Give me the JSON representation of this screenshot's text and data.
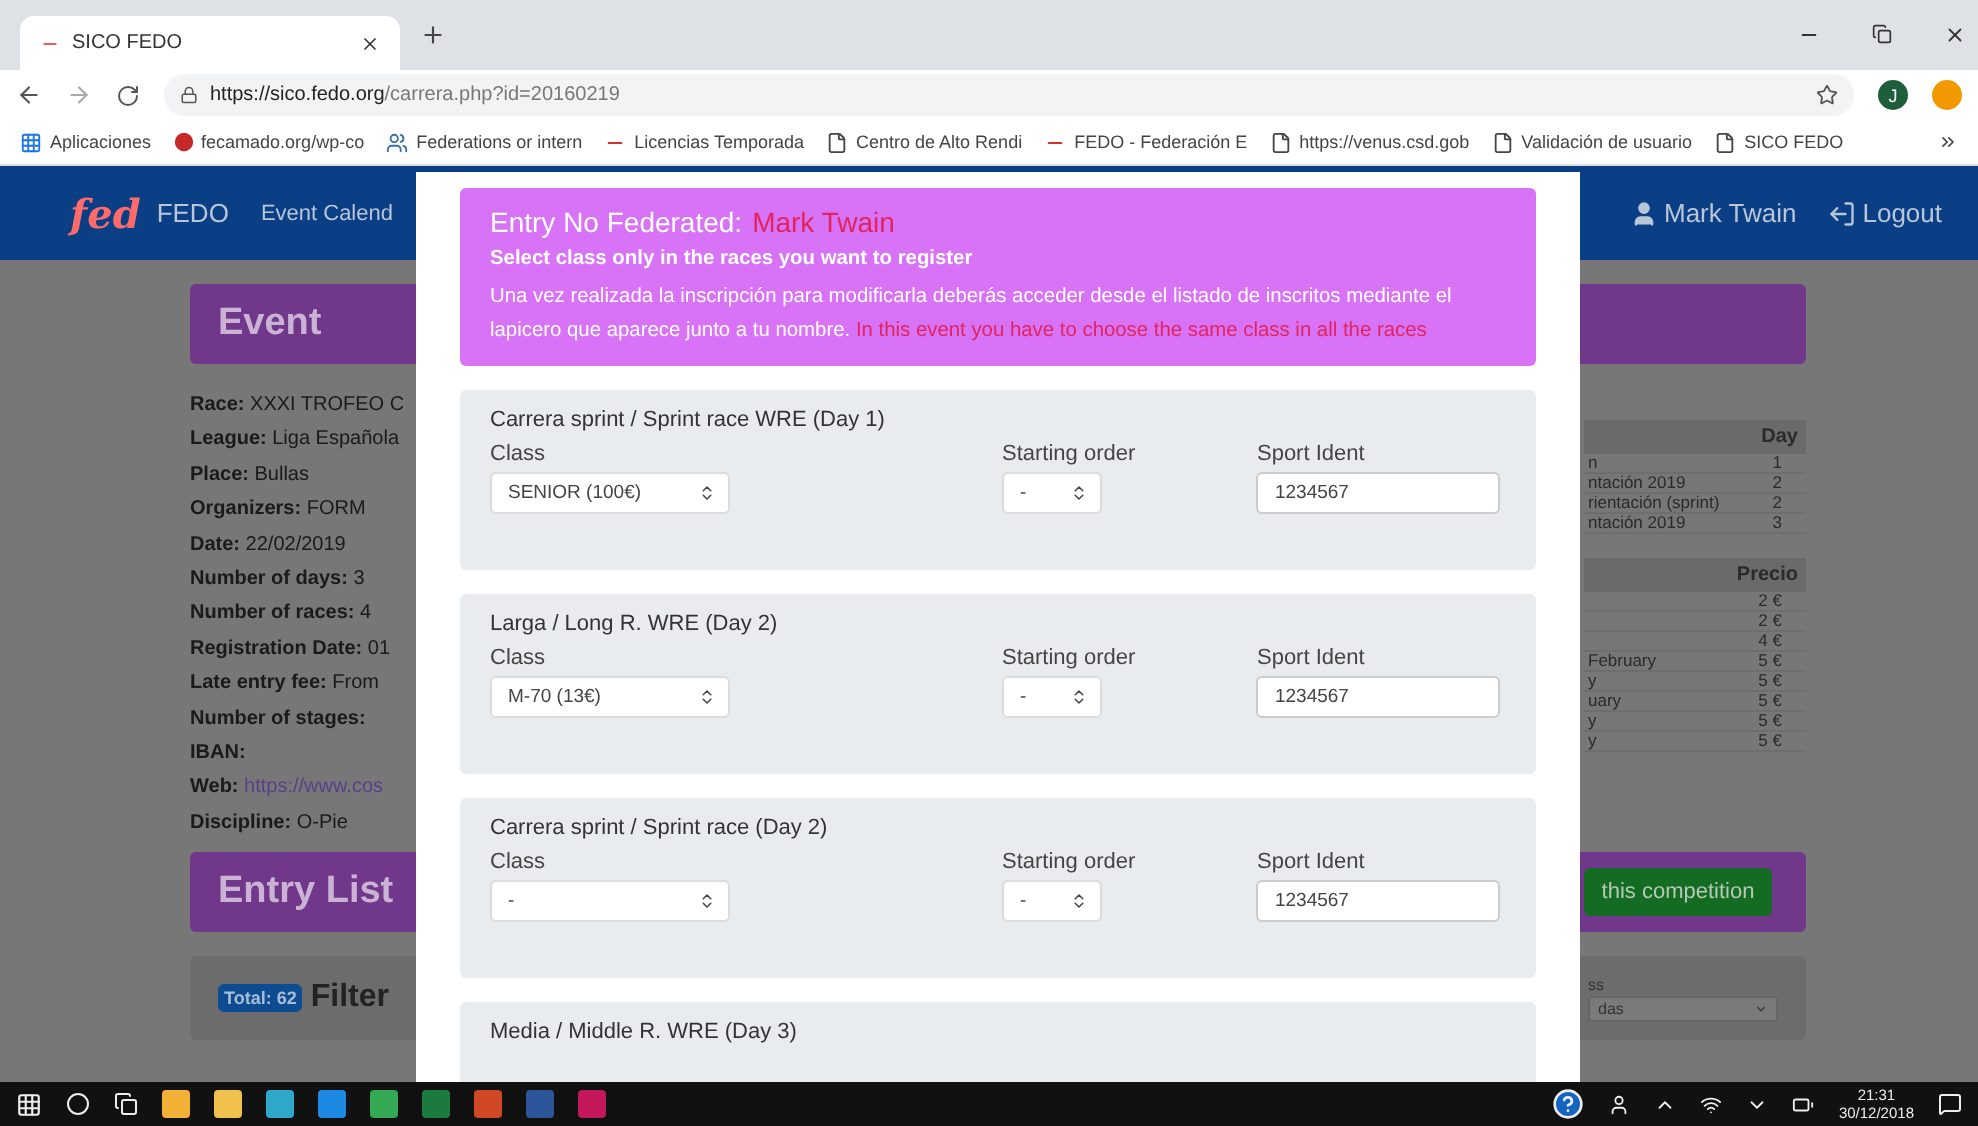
{
  "browser": {
    "tab": {
      "title": "SICO FEDO"
    },
    "url": {
      "host": "https://sico.fedo.org",
      "path": "/carrera.php?id=20160219"
    },
    "profile_initial": "J",
    "bookmarks": [
      {
        "label": "Aplicaciones",
        "kind": "apps"
      },
      {
        "label": "fecamado.org/wp-co",
        "kind": "site"
      },
      {
        "label": "Federations or intern",
        "kind": "person"
      },
      {
        "label": "Licencias Temporada",
        "kind": "fedo"
      },
      {
        "label": "Centro de Alto Rendi",
        "kind": "page"
      },
      {
        "label": "FEDO - Federación E",
        "kind": "fedo"
      },
      {
        "label": "https://venus.csd.gob",
        "kind": "page"
      },
      {
        "label": "Validación de usuario",
        "kind": "page"
      },
      {
        "label": "SICO FEDO",
        "kind": "page"
      }
    ]
  },
  "navbar": {
    "logo": "fed",
    "brand": "FEDO",
    "nav_item": "Event Calend",
    "user": "Mark Twain",
    "logout": "Logout"
  },
  "event": {
    "heading": "Event",
    "details": [
      {
        "label": "Race:",
        "value": "XXXI TROFEO C"
      },
      {
        "label": "League:",
        "value": "Liga Española"
      },
      {
        "label": "Place:",
        "value": "Bullas"
      },
      {
        "label": "Organizers:",
        "value": "FORM"
      },
      {
        "label": "Date:",
        "value": "22/02/2019"
      },
      {
        "label": "Number of days:",
        "value": "3"
      },
      {
        "label": "Number of races:",
        "value": "4"
      },
      {
        "label": "Registration Date:",
        "value": "01"
      },
      {
        "label": "Late entry fee:",
        "value": "From"
      },
      {
        "label": "Number of stages:"
      },
      {
        "label": "IBAN:"
      },
      {
        "label": "Web:",
        "value": "https://www.cos",
        "kind": "link"
      },
      {
        "label": "Discipline:",
        "value": "O-Pie"
      }
    ]
  },
  "races_table": {
    "header": "Day",
    "rows": [
      {
        "name": "n",
        "day": "1"
      },
      {
        "name": "ntación 2019",
        "day": "2"
      },
      {
        "name": "rientación (sprint)",
        "day": "2"
      },
      {
        "name": "ntación 2019",
        "day": "3"
      }
    ]
  },
  "prices_table": {
    "header": "Precio",
    "rows": [
      {
        "price": "2 €"
      },
      {
        "price": "2 €"
      },
      {
        "price": "4 €"
      },
      {
        "name": "February",
        "price": "5 €"
      },
      {
        "name": "y",
        "price": "5 €"
      },
      {
        "name": "uary",
        "price": "5 €"
      },
      {
        "name": "y",
        "price": "5 €"
      },
      {
        "name": "y",
        "price": "5 €"
      }
    ]
  },
  "entry_list": {
    "heading": "Entry List",
    "register_button": "this competition",
    "total": "Total: 62",
    "filters": "Filter",
    "filter_label": "ss",
    "filter_select": "das"
  },
  "modal": {
    "title_label": "Entry No Federated:",
    "title_name": "Mark Twain",
    "subtitle": "Select class only in the races you want to register",
    "notice": "Una vez realizada la inscripción para modificarla deberás acceder desde el listado de inscritos mediante el lapicero que aparece junto a tu nombre.",
    "warning": "In this event you have to choose the same class in all the races",
    "races": [
      {
        "title": "Carrera sprint / Sprint race WRE (Day 1)",
        "class_label": "Class",
        "class_value": "SENIOR (100€)",
        "order_label": "Starting order",
        "order_value": "-",
        "si_label": "Sport Ident",
        "si_value": "1234567"
      },
      {
        "title": "Larga / Long R. WRE (Day 2)",
        "class_label": "Class",
        "class_value": "M-70 (13€)",
        "order_label": "Starting order",
        "order_value": "-",
        "si_label": "Sport Ident",
        "si_value": "1234567"
      },
      {
        "title": "Carrera sprint / Sprint race (Day 2)",
        "class_label": "Class",
        "class_value": "-",
        "order_label": "Starting order",
        "order_value": "-",
        "si_label": "Sport Ident",
        "si_value": "1234567"
      },
      {
        "title": "Media / Middle R. WRE (Day 3)"
      }
    ]
  },
  "taskbar": {
    "apps": [
      {
        "color": "#f2b134"
      },
      {
        "color": "#f0c24b"
      },
      {
        "color": "#2fa8c9"
      },
      {
        "color": "#1e88e5"
      },
      {
        "color": "#34a853"
      },
      {
        "color": "#1d7a3e"
      },
      {
        "color": "#d24726"
      },
      {
        "color": "#2b579a"
      },
      {
        "color": "#c2185b"
      }
    ],
    "time": "21:31",
    "date": "30/12/2018"
  }
}
